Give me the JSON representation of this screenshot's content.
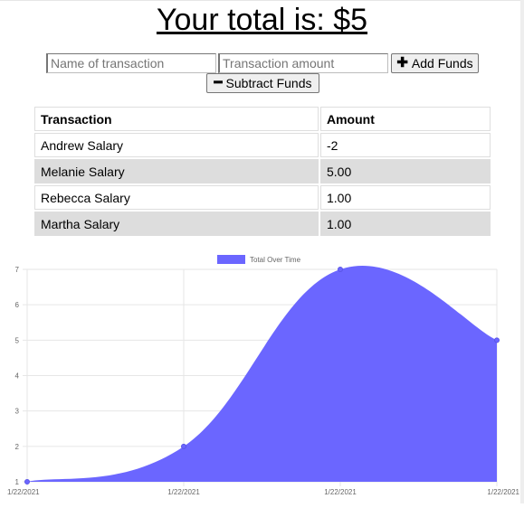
{
  "header": {
    "total_text": "Your total is: $5"
  },
  "form": {
    "name_placeholder": "Name of transaction",
    "amount_placeholder": "Transaction amount",
    "add_label": "Add Funds",
    "subtract_label": "Subtract Funds",
    "add_icon": "plus-icon",
    "subtract_icon": "minus-icon"
  },
  "table": {
    "headers": [
      "Transaction",
      "Amount"
    ],
    "rows": [
      {
        "name": "Andrew Salary",
        "amount": "-2"
      },
      {
        "name": "Melanie Salary",
        "amount": "5.00"
      },
      {
        "name": "Rebecca Salary",
        "amount": "1.00"
      },
      {
        "name": "Martha Salary",
        "amount": "1.00"
      }
    ]
  },
  "colors": {
    "series_fill": "#6b66ff",
    "row_alt": "#dddddd",
    "grid": "#e6e6e6"
  },
  "chart_data": {
    "type": "area",
    "x": [
      "1/22/2021",
      "1/22/2021",
      "1/22/2021",
      "1/22/2021"
    ],
    "series": [
      {
        "name": "Total Over Time",
        "values": [
          1,
          2,
          7,
          5
        ]
      }
    ],
    "yticks": [
      1,
      2,
      3,
      4,
      5,
      6,
      7
    ],
    "ylim": [
      1,
      7
    ],
    "grid": true,
    "legend": "top"
  }
}
